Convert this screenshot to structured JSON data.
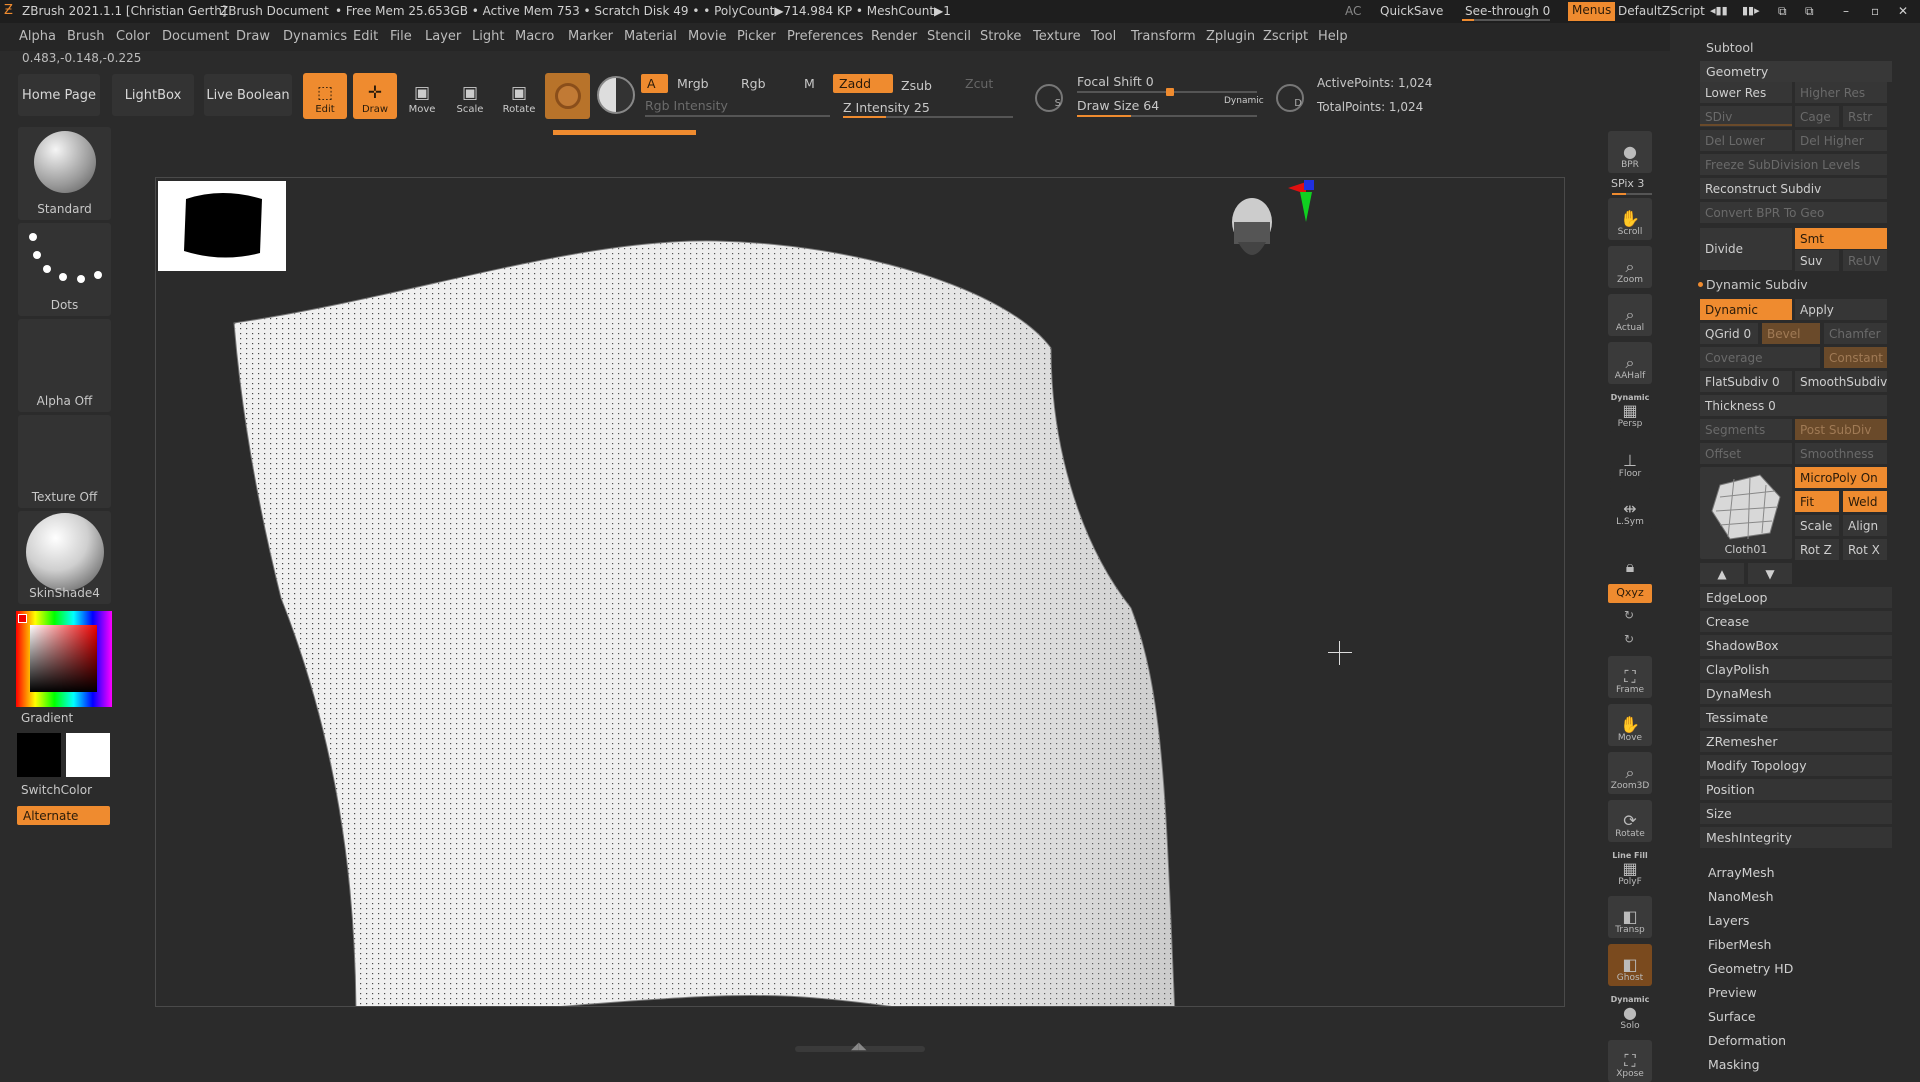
{
  "titlebar": {
    "app": "ZBrush 2021.1.1 [Christian Gerth]",
    "doc": "ZBrush Document",
    "stats": "• Free Mem 25.653GB • Active Mem 753 • Scratch Disk 49 • • PolyCount▶714.984 KP • MeshCount▶1",
    "ac": "AC",
    "quicksave": "QuickSave",
    "seethrough": "See-through  0",
    "menus": "Menus",
    "script": "DefaultZScript"
  },
  "menu": [
    "Alpha",
    "Brush",
    "Color",
    "Document",
    "Draw",
    "Dynamics",
    "Edit",
    "File",
    "Layer",
    "Light",
    "Macro",
    "Marker",
    "Material",
    "Movie",
    "Picker",
    "Preferences",
    "Render",
    "Stencil",
    "Stroke",
    "Texture",
    "Tool",
    "Transform",
    "Zplugin",
    "Zscript",
    "Help"
  ],
  "coords": "0.483,-0.148,-0.225",
  "toolbar": {
    "home": "Home Page",
    "lightbox": "LightBox",
    "liveboolean": "Live Boolean",
    "edit": "Edit",
    "draw": "Draw",
    "move": "Move",
    "scale": "Scale",
    "rotate": "Rotate",
    "a": "A",
    "mrgb": "Mrgb",
    "rgb": "Rgb",
    "m": "M",
    "zadd": "Zadd",
    "zsub": "Zsub",
    "zcut": "Zcut",
    "rgb_intensity": "Rgb Intensity",
    "z_intensity": "Z Intensity 25",
    "focal_shift": "Focal Shift 0",
    "draw_size": "Draw Size 64",
    "dynamic": "Dynamic",
    "active_points": "ActivePoints: 1,024",
    "total_points": "TotalPoints: 1,024",
    "z_intensity_pct": 25,
    "focal_pct": 0,
    "draw_size_pct": 0.3
  },
  "left": {
    "brush": "Standard",
    "stroke": "Dots",
    "alpha": "Alpha Off",
    "texture": "Texture Off",
    "material": "SkinShade4",
    "gradient": "Gradient",
    "switchcolor": "SwitchColor",
    "alternate": "Alternate"
  },
  "tray": {
    "bpr": "BPR",
    "spix": "SPix 3",
    "scroll": "Scroll",
    "zoom": "Zoom",
    "actual": "Actual",
    "aahalf": "AAHalf",
    "persp": "Persp",
    "dynamic": "Dynamic",
    "floor": "Floor",
    "lsym": "L.Sym",
    "xyz": "Qxyz",
    "frame": "Frame",
    "move": "Move",
    "zoom3d": "Zoom3D",
    "rotate": "Rotate",
    "linefill": "Line Fill",
    "polyf": "PolyF",
    "transp": "Transp",
    "ghost": "Ghost",
    "solo": "Solo",
    "xpose": "Xpose"
  },
  "right": {
    "subtool": "Subtool",
    "geometry": "Geometry",
    "lower_res": "Lower Res",
    "higher_res": "Higher Res",
    "sdiv": "SDiv",
    "cage": "Cage",
    "rstr": "Rstr",
    "del_lower": "Del Lower",
    "del_higher": "Del Higher",
    "freeze": "Freeze SubDivision Levels",
    "reconstruct": "Reconstruct Subdiv",
    "convert": "Convert BPR To Geo",
    "divide": "Divide",
    "smt": "Smt",
    "suv": "Suv",
    "reuv": "ReUV",
    "dynamic_subdiv": "Dynamic Subdiv",
    "dynamic": "Dynamic",
    "apply": "Apply",
    "qgrid": "QGrid 0",
    "bevel": "Bevel",
    "chamfer": "Chamfer",
    "coverage": "Coverage",
    "constant": "Constant",
    "flatsubdiv": "FlatSubdiv 0",
    "smoothsubdiv": "SmoothSubdiv",
    "thickness": "Thickness 0",
    "segments": "Segments",
    "post_subdiv": "Post SubDiv",
    "offset": "Offset",
    "smoothness": "Smoothness",
    "micropoly": "MicroPoly On",
    "fit": "Fit",
    "weld": "Weld",
    "scale": "Scale",
    "align": "Align",
    "rotz": "Rot Z",
    "rotx": "Rot X",
    "cloth": "Cloth01",
    "geo_items": [
      "EdgeLoop",
      "Crease",
      "ShadowBox",
      "ClayPolish",
      "DynaMesh",
      "Tessimate",
      "ZRemesher",
      "Modify Topology",
      "Position",
      "Size",
      "MeshIntegrity"
    ],
    "tool_items": [
      "ArrayMesh",
      "NanoMesh",
      "Layers",
      "FiberMesh",
      "Geometry HD",
      "Preview",
      "Surface",
      "Deformation",
      "Masking"
    ]
  },
  "colors": {
    "accent": "#ef8b2f",
    "bg": "#2b2b2b",
    "mesh": "#ececec"
  }
}
